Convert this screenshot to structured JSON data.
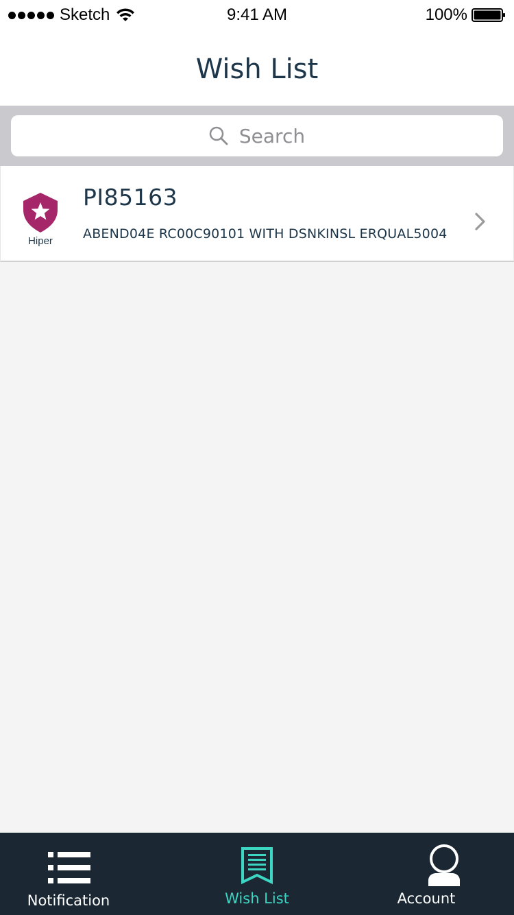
{
  "status_bar": {
    "carrier": "Sketch",
    "time": "9:41 AM",
    "battery_percent": "100%"
  },
  "nav": {
    "title": "Wish List"
  },
  "search": {
    "placeholder": "Search"
  },
  "list": {
    "items": [
      {
        "badge_label": "Hiper",
        "badge_icon": "shield-star-icon",
        "badge_color": "#a5276a",
        "title": "PI85163",
        "subtitle": "ABEND04E RC00C90101 WITH DSNKINSL ERQUAL5004"
      }
    ]
  },
  "tab_bar": {
    "background": "#1b2834",
    "active_color": "#3dd6c3",
    "tabs": [
      {
        "label": "Notification",
        "icon": "list-icon",
        "active": false
      },
      {
        "label": "Wish List",
        "icon": "bookmark-list-icon",
        "active": true
      },
      {
        "label": "Account",
        "icon": "user-icon",
        "active": false
      }
    ]
  }
}
